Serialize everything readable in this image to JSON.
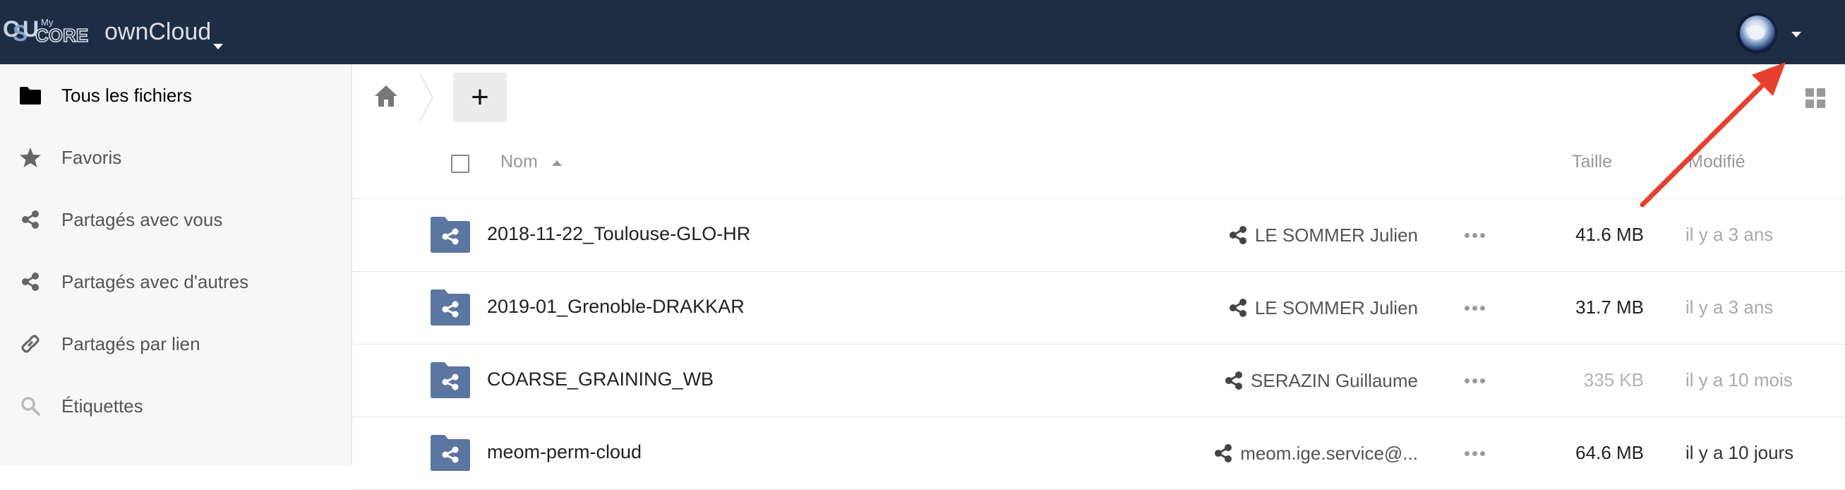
{
  "header": {
    "logo_alt": "OSU MyCORE",
    "logo_text": "CORE",
    "logo_small": "My",
    "app_name": "ownCloud"
  },
  "sidebar": {
    "items": [
      {
        "label": "Tous les fichiers",
        "icon": "folder-icon",
        "active": true
      },
      {
        "label": "Favoris",
        "icon": "star-icon"
      },
      {
        "label": "Partagés avec vous",
        "icon": "share-icon"
      },
      {
        "label": "Partagés avec d'autres",
        "icon": "share-icon"
      },
      {
        "label": "Partagés par lien",
        "icon": "link-icon"
      },
      {
        "label": "Étiquettes",
        "icon": "search-icon"
      }
    ]
  },
  "toolbar": {
    "new_label": "+"
  },
  "table": {
    "columns": {
      "name": "Nom",
      "size": "Taille",
      "modified": "Modifié"
    },
    "rows": [
      {
        "name": "2018-11-22_Toulouse-GLO-HR",
        "owner": "LE SOMMER Julien",
        "size": "41.6 MB",
        "modified": "il y a 3 ans"
      },
      {
        "name": "2019-01_Grenoble-DRAKKAR",
        "owner": "LE SOMMER Julien",
        "size": "31.7 MB",
        "modified": "il y a 3 ans"
      },
      {
        "name": "COARSE_GRAINING_WB",
        "owner": "SERAZIN Guillaume",
        "size": "335 KB",
        "modified": "il y a 10 mois"
      },
      {
        "name": "meom-perm-cloud",
        "owner": "meom.ige.service@...",
        "size": "64.6 MB",
        "modified": "il y a 10 jours"
      }
    ]
  },
  "colors": {
    "header_bg": "#1d2d44",
    "folder": "#5b76a0",
    "arrow": "#e8402f",
    "sidebar_bg": "#f7f7f7"
  }
}
